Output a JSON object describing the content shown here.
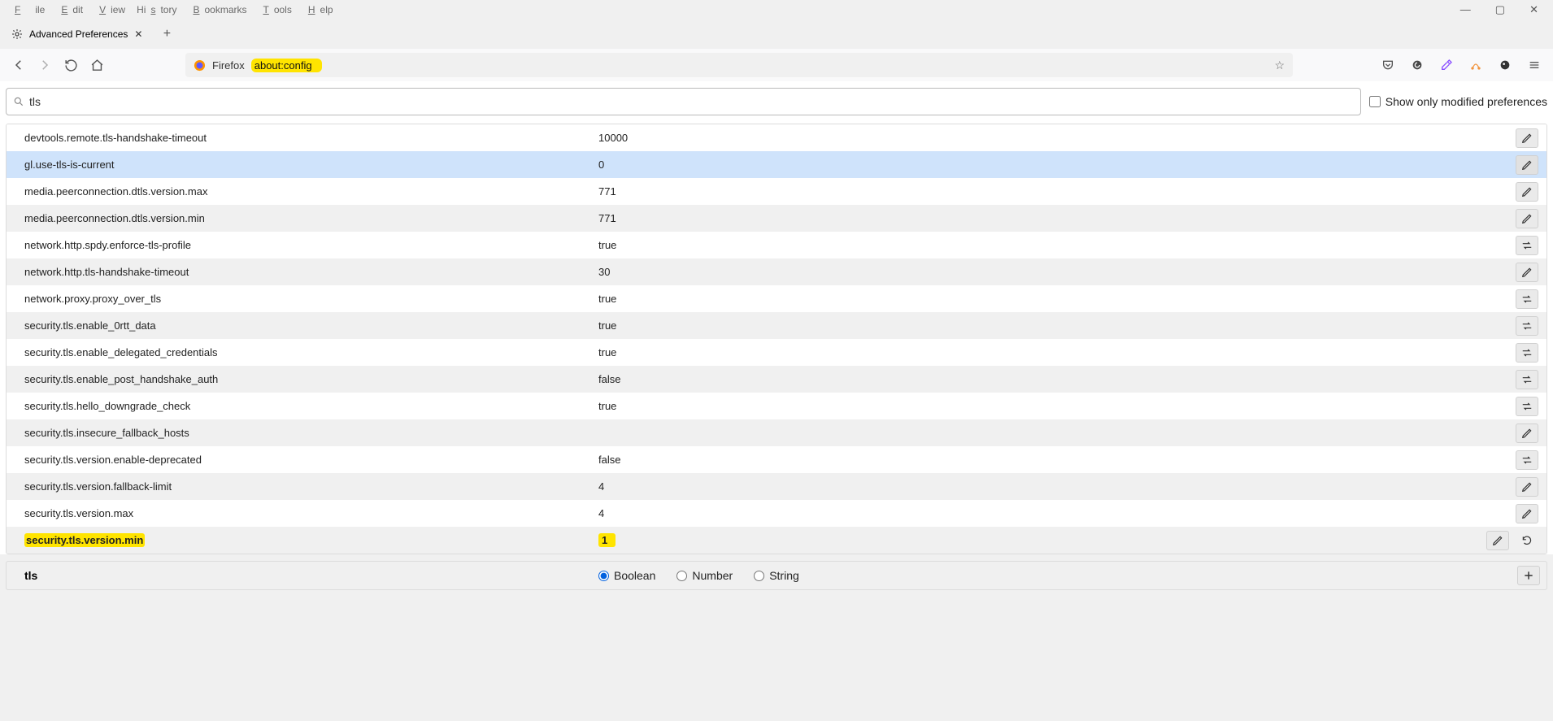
{
  "menu": {
    "file": "File",
    "edit": "Edit",
    "view": "View",
    "history": "History",
    "bookmarks": "Bookmarks",
    "tools": "Tools",
    "help": "Help"
  },
  "tab": {
    "title": "Advanced Preferences"
  },
  "url": {
    "identity": "Firefox",
    "address": "about:config"
  },
  "search": {
    "value": "tls"
  },
  "show_only_label": "Show only modified preferences",
  "prefs": [
    {
      "name": "devtools.remote.tls-handshake-timeout",
      "value": "10000",
      "action": "edit"
    },
    {
      "name": "gl.use-tls-is-current",
      "value": "0",
      "action": "edit",
      "selected": true
    },
    {
      "name": "media.peerconnection.dtls.version.max",
      "value": "771",
      "action": "edit"
    },
    {
      "name": "media.peerconnection.dtls.version.min",
      "value": "771",
      "action": "edit"
    },
    {
      "name": "network.http.spdy.enforce-tls-profile",
      "value": "true",
      "action": "toggle"
    },
    {
      "name": "network.http.tls-handshake-timeout",
      "value": "30",
      "action": "edit"
    },
    {
      "name": "network.proxy.proxy_over_tls",
      "value": "true",
      "action": "toggle"
    },
    {
      "name": "security.tls.enable_0rtt_data",
      "value": "true",
      "action": "toggle"
    },
    {
      "name": "security.tls.enable_delegated_credentials",
      "value": "true",
      "action": "toggle"
    },
    {
      "name": "security.tls.enable_post_handshake_auth",
      "value": "false",
      "action": "toggle"
    },
    {
      "name": "security.tls.hello_downgrade_check",
      "value": "true",
      "action": "toggle"
    },
    {
      "name": "security.tls.insecure_fallback_hosts",
      "value": "",
      "action": "edit"
    },
    {
      "name": "security.tls.version.enable-deprecated",
      "value": "false",
      "action": "toggle"
    },
    {
      "name": "security.tls.version.fallback-limit",
      "value": "4",
      "action": "edit"
    },
    {
      "name": "security.tls.version.max",
      "value": "4",
      "action": "edit"
    },
    {
      "name": "security.tls.version.min",
      "value": "1",
      "action": "edit",
      "bold": true,
      "hl": true,
      "reset": true
    }
  ],
  "addbar": {
    "name": "tls",
    "types": {
      "boolean": "Boolean",
      "number": "Number",
      "string": "String"
    },
    "selected": "boolean"
  }
}
